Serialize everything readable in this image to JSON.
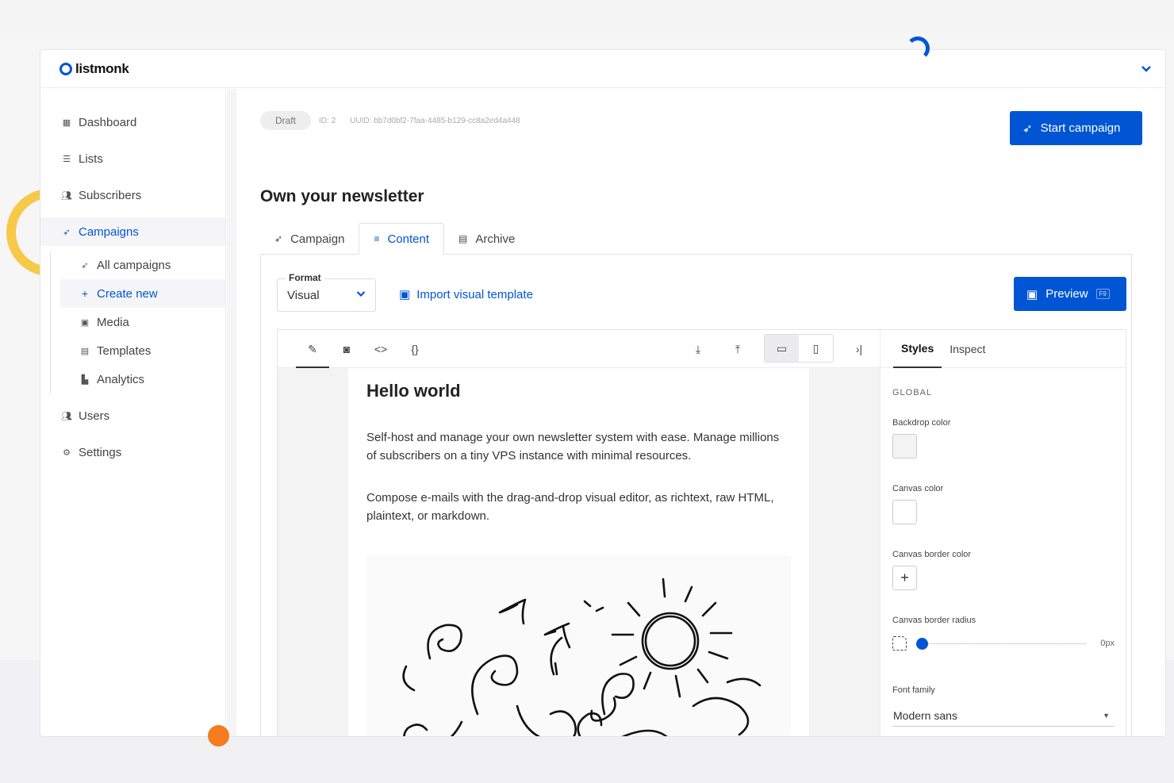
{
  "app": {
    "name": "listmonk"
  },
  "sidebar": {
    "items": [
      {
        "label": "Dashboard",
        "icon": "dashboard-icon"
      },
      {
        "label": "Lists",
        "icon": "list-icon"
      },
      {
        "label": "Subscribers",
        "icon": "users-icon"
      },
      {
        "label": "Campaigns",
        "icon": "rocket-icon"
      }
    ],
    "campaign_sub": [
      {
        "label": "All campaigns",
        "icon": "rocket-icon"
      },
      {
        "label": "Create new",
        "icon": "plus-icon"
      },
      {
        "label": "Media",
        "icon": "media-icon"
      },
      {
        "label": "Templates",
        "icon": "template-icon"
      },
      {
        "label": "Analytics",
        "icon": "chart-icon"
      }
    ],
    "bottom_items": [
      {
        "label": "Users",
        "icon": "users-icon"
      },
      {
        "label": "Settings",
        "icon": "gear-icon"
      }
    ]
  },
  "campaign": {
    "status": "Draft",
    "id_text": "ID: 2",
    "uuid_text": "UUID: bb7d0bf2-7faa-4485-b129-cc8a2ed4a448",
    "title": "Own your newsletter",
    "start_label": "Start campaign"
  },
  "tabs": [
    {
      "label": "Campaign",
      "icon": "rocket-icon"
    },
    {
      "label": "Content",
      "icon": "lines-icon"
    },
    {
      "label": "Archive",
      "icon": "archive-icon"
    }
  ],
  "content": {
    "format_label": "Format",
    "format_value": "Visual",
    "import_label": "Import visual template",
    "preview_label": "Preview",
    "preview_kbd": "F9"
  },
  "email": {
    "heading": "Hello world",
    "para1": "Self-host and manage your own newsletter system with ease. Manage millions of subscribers on a tiny VPS instance with minimal resources.",
    "para2": "Compose e-mails with the drag-and-drop visual editor, as richtext, raw HTML, plaintext, or markdown."
  },
  "styles_panel": {
    "tab_styles": "Styles",
    "tab_inspect": "Inspect",
    "section": "GLOBAL",
    "backdrop_label": "Backdrop color",
    "backdrop_color": "#f3f3f4",
    "canvas_label": "Canvas color",
    "canvas_color": "#ffffff",
    "border_color_label": "Canvas border color",
    "border_radius_label": "Canvas border radius",
    "border_radius_value": "0px",
    "font_label": "Font family",
    "font_value": "Modern sans"
  },
  "colors": {
    "accent": "#0055d4"
  }
}
